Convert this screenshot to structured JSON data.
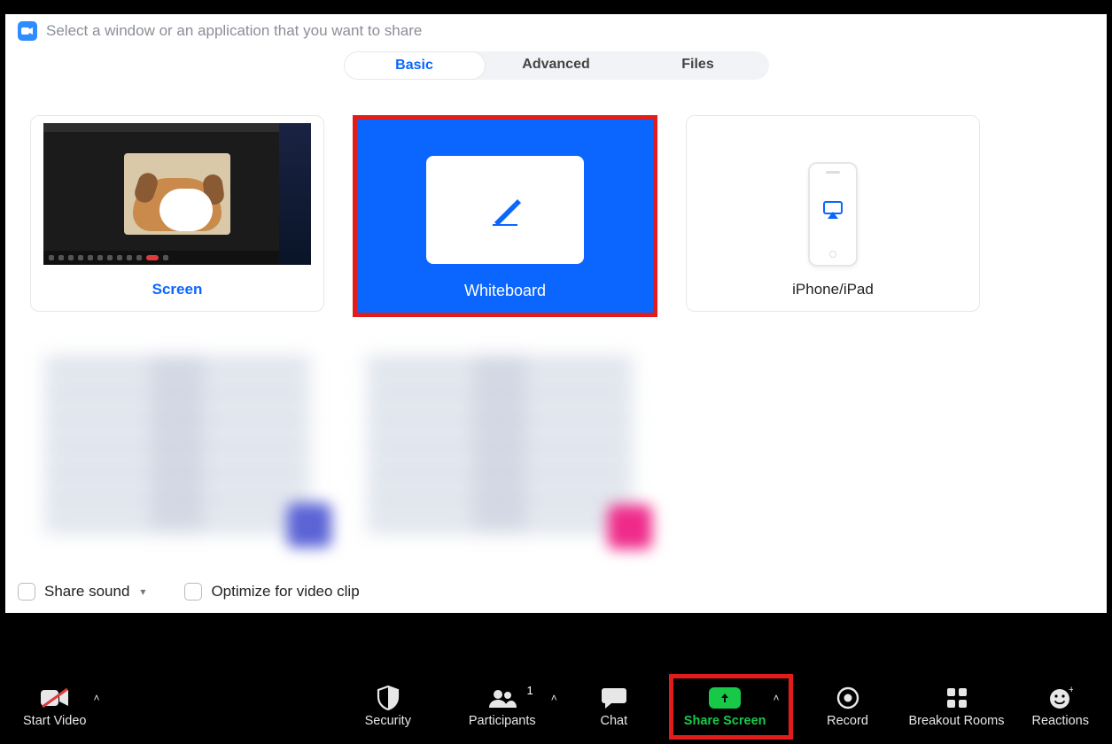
{
  "dialog": {
    "title": "Select a window or an application that you want to share",
    "tabs": {
      "basic": "Basic",
      "advanced": "Advanced",
      "files": "Files",
      "active": "basic"
    },
    "cards": {
      "screen": "Screen",
      "whiteboard": "Whiteboard",
      "iphone": "iPhone/iPad"
    },
    "options": {
      "share_sound": "Share sound",
      "optimize_video": "Optimize for video clip"
    }
  },
  "toolbar": {
    "start_video": "Start Video",
    "security": "Security",
    "participants": "Participants",
    "participants_count": "1",
    "chat": "Chat",
    "share_screen": "Share Screen",
    "record": "Record",
    "breakout_rooms": "Breakout Rooms",
    "reactions": "Reactions"
  },
  "colors": {
    "accent": "#0a66ff",
    "highlight": "#e21b1b",
    "share_green": "#18c948"
  }
}
